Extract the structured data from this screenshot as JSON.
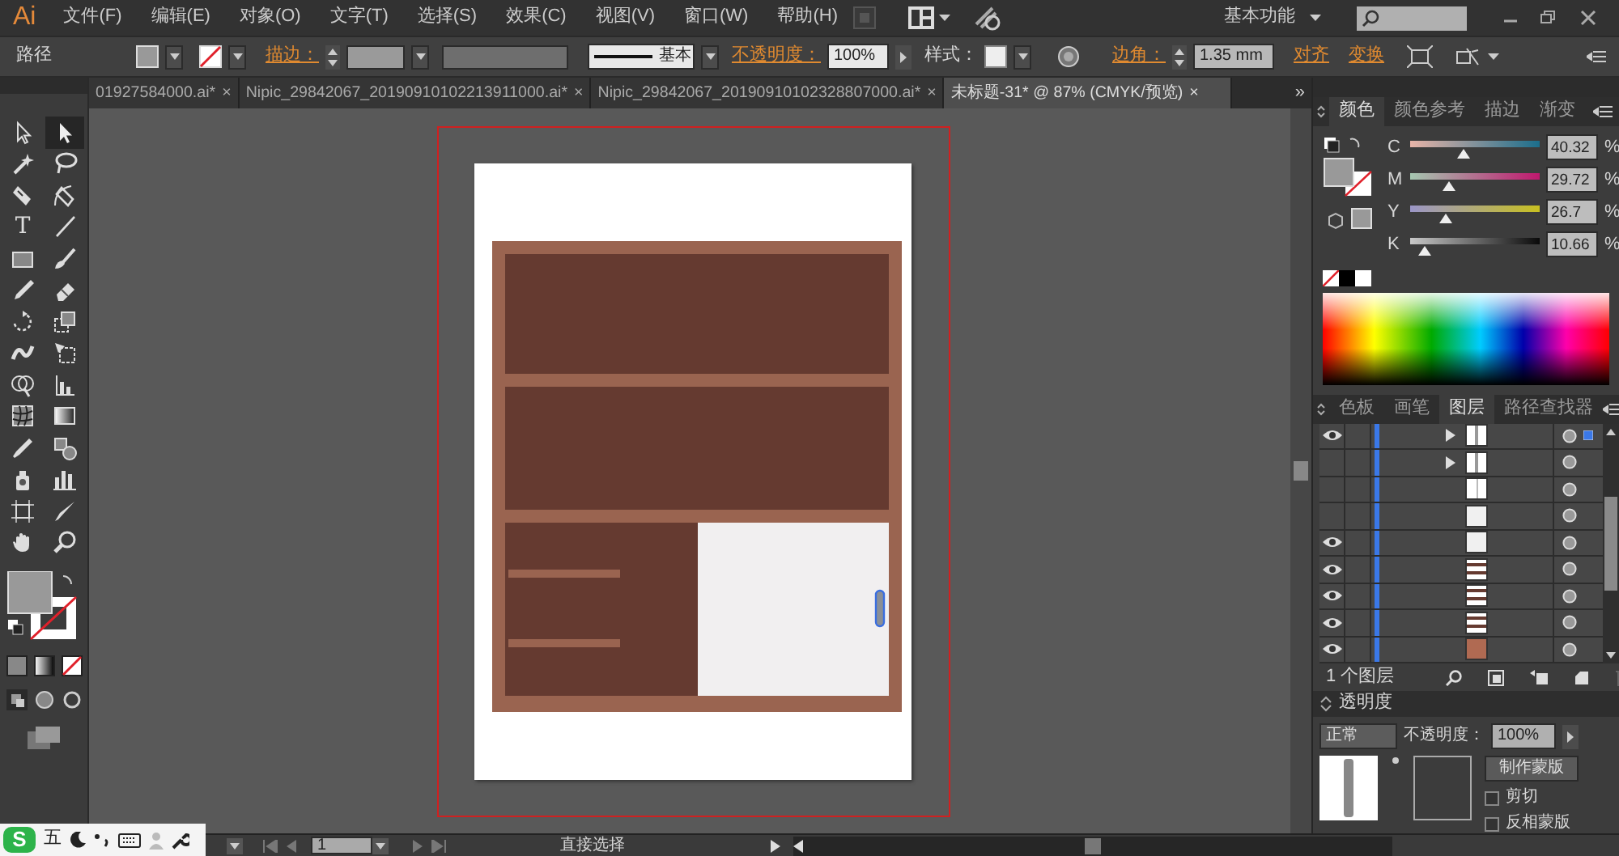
{
  "app": {
    "logo": "Ai"
  },
  "menu": [
    {
      "label": "文件(F)"
    },
    {
      "label": "编辑(E)"
    },
    {
      "label": "对象(O)"
    },
    {
      "label": "文字(T)"
    },
    {
      "label": "选择(S)"
    },
    {
      "label": "效果(C)"
    },
    {
      "label": "视图(V)"
    },
    {
      "label": "窗口(W)"
    },
    {
      "label": "帮助(H)"
    }
  ],
  "workspace": {
    "label": "基本功能"
  },
  "control_bar": {
    "selection": "路径",
    "stroke_label": "描边：",
    "stroke_style": "基本",
    "opacity_label": "不透明度：",
    "opacity": "100%",
    "style_label": "样式：",
    "corner_label": "边角：",
    "corner_value": "1.35 mm",
    "align_link": "对齐",
    "transform_link": "变换"
  },
  "doc_tabs": [
    {
      "label": "01927584000.ai*",
      "close": "×",
      "selected": false
    },
    {
      "label": "Nipic_29842067_20190910102213911000.ai*",
      "close": "×",
      "selected": false
    },
    {
      "label": "Nipic_29842067_20190910102328807000.ai*",
      "close": "×",
      "selected": false
    },
    {
      "label": "未标题-31* @ 87% (CMYK/预览)",
      "close": "×",
      "selected": true
    }
  ],
  "tab_overflow": "»",
  "tools": [
    {
      "selected": false
    },
    {
      "selected": true
    },
    {
      "selected": false
    },
    {
      "selected": false
    },
    {
      "selected": false
    },
    {
      "selected": false
    },
    {
      "selected": false,
      "glyph": "T"
    },
    {
      "selected": false
    },
    {
      "selected": false
    },
    {
      "selected": false
    },
    {
      "selected": false
    },
    {
      "selected": false
    },
    {
      "selected": false
    },
    {
      "selected": false
    },
    {
      "selected": false
    },
    {
      "selected": false
    },
    {
      "selected": false
    },
    {
      "selected": false
    },
    {
      "selected": false
    },
    {
      "selected": false
    },
    {
      "selected": false
    },
    {
      "selected": false
    },
    {
      "selected": false
    },
    {
      "selected": false
    },
    {
      "selected": false
    },
    {
      "selected": false
    },
    {
      "selected": false
    },
    {
      "selected": false
    }
  ],
  "color_panel": {
    "tabs": [
      {
        "label": "颜色",
        "selected": true
      },
      {
        "label": "颜色参考",
        "selected": false
      },
      {
        "label": "描边",
        "selected": false
      },
      {
        "label": "渐变",
        "selected": false
      }
    ],
    "sliders": [
      {
        "name": "C",
        "value": "40.32",
        "unit": "%",
        "level": 0.41
      },
      {
        "name": "M",
        "value": "29.72",
        "unit": "%",
        "level": 0.3
      },
      {
        "name": "Y",
        "value": "26.7",
        "unit": "%",
        "level": 0.27
      },
      {
        "name": "K",
        "value": "10.66",
        "unit": "%",
        "level": 0.11
      }
    ]
  },
  "layers_panel": {
    "tabs": [
      {
        "label": "色板",
        "selected": false
      },
      {
        "label": "画笔",
        "selected": false
      },
      {
        "label": "图层",
        "selected": true
      },
      {
        "label": "路径查找器",
        "selected": false
      }
    ],
    "rows": [
      {
        "visible": true,
        "expandable": true,
        "kind": "bars",
        "selected": true
      },
      {
        "visible": false,
        "expandable": true,
        "kind": "bars",
        "selected": false
      },
      {
        "visible": false,
        "expandable": false,
        "kind": "split",
        "selected": false
      },
      {
        "visible": false,
        "expandable": false,
        "kind": "plain",
        "selected": false
      },
      {
        "visible": true,
        "expandable": false,
        "kind": "plain",
        "selected": false
      },
      {
        "visible": true,
        "expandable": false,
        "kind": "stripes",
        "selected": false
      },
      {
        "visible": true,
        "expandable": false,
        "kind": "stripes",
        "selected": false
      },
      {
        "visible": true,
        "expandable": false,
        "kind": "stripes",
        "selected": false
      },
      {
        "visible": true,
        "expandable": false,
        "kind": "brown",
        "selected": false
      }
    ],
    "count": "1 个图层"
  },
  "transparency_panel": {
    "title": "透明度",
    "mode": "正常",
    "opacity_label": "不透明度：",
    "opacity": "100%",
    "mask_button": "制作蒙版",
    "options": [
      {
        "label": "剪切",
        "checked": false
      },
      {
        "label": "反相蒙版",
        "checked": false
      }
    ]
  },
  "status_bar": {
    "page": "1",
    "tool": "直接选择"
  },
  "ime_bar": {
    "logo": "S",
    "mode": "五"
  }
}
